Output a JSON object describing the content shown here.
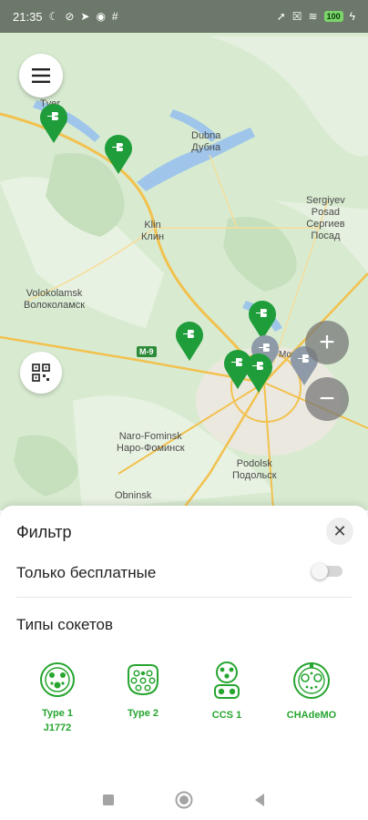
{
  "status": {
    "time": "21:35",
    "battery": "100",
    "left_icons": [
      "moon-icon",
      "crossed-icon",
      "telegram-icon",
      "app-icon",
      "hash-icon"
    ],
    "right_icons": [
      "location-icon",
      "close-box-icon",
      "wifi-icon",
      "battery-icon",
      "charging-icon"
    ]
  },
  "map": {
    "labels": {
      "tver": "Tver",
      "dubna": "Dubna",
      "dubna_ru": "Дубна",
      "sergiyev": "Sergiyev",
      "posad": "Posad",
      "sergiev_ru": "Сергиев",
      "posad_ru": "Посад",
      "klin": "Klin",
      "klin_ru": "Клин",
      "volokolamsk": "Volokolamsk",
      "volokolamsk_ru": "Волоколамск",
      "naro": "Naro-Fominsk",
      "naro_ru": "Наро-Фоминск",
      "podolsk": "Podolsk",
      "podolsk_ru": "Подольск",
      "obninsk": "Obninsk",
      "moscow_fragment": "Moskva",
      "road_m9": "M-9"
    },
    "colors": {
      "pin_green": "#1f9d3a",
      "pin_gray": "#8e9aa8"
    }
  },
  "filter": {
    "title": "Фильтр",
    "close_label": "✕",
    "free_only_label": "Только бесплатные",
    "free_only_enabled": false,
    "socket_types_title": "Типы сокетов",
    "sockets": [
      {
        "line1": "Type 1",
        "line2": "J1772",
        "icon": "type1-socket-icon"
      },
      {
        "line1": "Type 2",
        "line2": "",
        "icon": "type2-socket-icon"
      },
      {
        "line1": "CCS 1",
        "line2": "",
        "icon": "ccs1-socket-icon"
      },
      {
        "line1": "CHAdeMO",
        "line2": "",
        "icon": "chademo-socket-icon"
      }
    ],
    "accent": "#26a52f"
  }
}
